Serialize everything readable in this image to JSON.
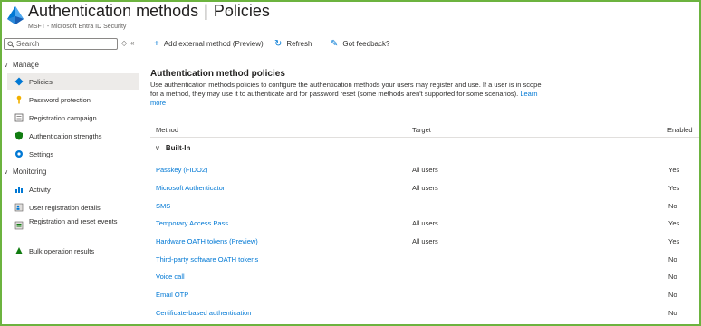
{
  "header": {
    "title_main": "Authentication methods",
    "title_sep": "|",
    "title_page": "Policies",
    "subtitle": "MSFT - Microsoft Entra ID Security"
  },
  "sidebar": {
    "search_placeholder": "Search",
    "groups": [
      {
        "label": "Manage",
        "items": [
          {
            "label": "Policies",
            "icon": "policy-icon",
            "active": true
          },
          {
            "label": "Password protection",
            "icon": "key-icon"
          },
          {
            "label": "Registration campaign",
            "icon": "list-icon"
          },
          {
            "label": "Authentication strengths",
            "icon": "shield-icon"
          },
          {
            "label": "Settings",
            "icon": "gear-icon"
          }
        ]
      },
      {
        "label": "Monitoring",
        "items": [
          {
            "label": "Activity",
            "icon": "activity-icon"
          },
          {
            "label": "User registration details",
            "icon": "user-list-icon"
          },
          {
            "label": "Registration and reset events",
            "icon": "events-icon"
          },
          {
            "label": "Bulk operation results",
            "icon": "bulk-icon"
          }
        ]
      }
    ]
  },
  "toolbar": {
    "add_label": "Add external method (Preview)",
    "refresh_label": "Refresh",
    "feedback_label": "Got feedback?"
  },
  "main": {
    "heading": "Authentication method policies",
    "description": "Use authentication methods policies to configure the authentication methods your users may register and use. If a user is in scope for a method, they may use it to authenticate and for password reset (some methods aren't supported for some scenarios).",
    "learn_more": "Learn more",
    "columns": {
      "method": "Method",
      "target": "Target",
      "enabled": "Enabled"
    },
    "group_label": "Built-In",
    "rows": [
      {
        "method": "Passkey (FIDO2)",
        "target": "All users",
        "enabled": "Yes"
      },
      {
        "method": "Microsoft Authenticator",
        "target": "All users",
        "enabled": "Yes"
      },
      {
        "method": "SMS",
        "target": "",
        "enabled": "No"
      },
      {
        "method": "Temporary Access Pass",
        "target": "All users",
        "enabled": "Yes"
      },
      {
        "method": "Hardware OATH tokens (Preview)",
        "target": "All users",
        "enabled": "Yes"
      },
      {
        "method": "Third-party software OATH tokens",
        "target": "",
        "enabled": "No"
      },
      {
        "method": "Voice call",
        "target": "",
        "enabled": "No"
      },
      {
        "method": "Email OTP",
        "target": "",
        "enabled": "No"
      },
      {
        "method": "Certificate-based authentication",
        "target": "",
        "enabled": "No"
      }
    ]
  },
  "colors": {
    "accent": "#0078d4",
    "frame": "#6cb33f",
    "active_bg": "#edebe9"
  }
}
